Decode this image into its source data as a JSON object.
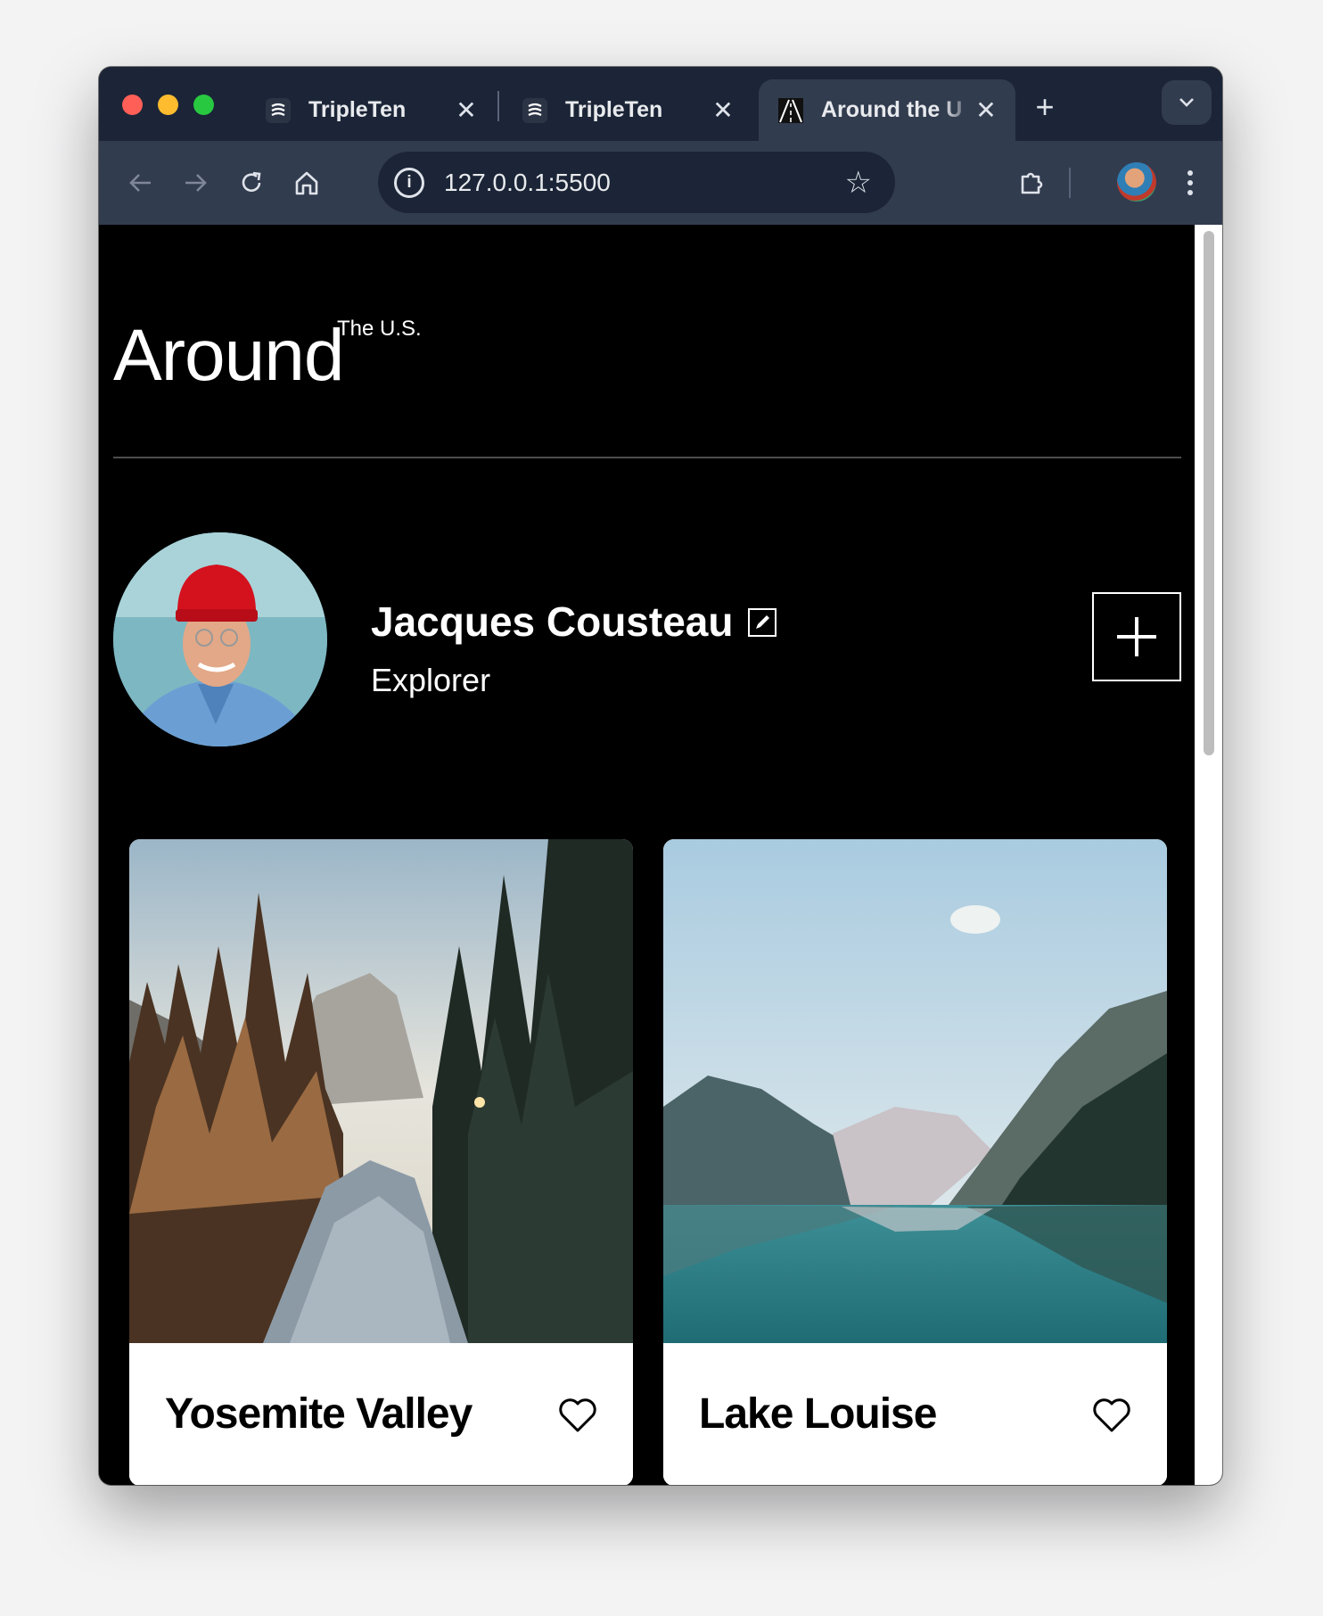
{
  "browser": {
    "tabs": [
      {
        "title": "TripleTen",
        "favicon": "tripleten-icon",
        "active": false
      },
      {
        "title": "TripleTen",
        "favicon": "tripleten-icon",
        "active": false
      },
      {
        "title": "Around the U",
        "favicon": "road-icon",
        "active": true
      }
    ],
    "close_glyph": "✕",
    "new_tab_glyph": "+",
    "url": "127.0.0.1:5500",
    "info_glyph": "i",
    "star_glyph": "☆"
  },
  "page": {
    "logo": {
      "main": "Around",
      "sup": "The U.S."
    },
    "profile": {
      "name": "Jacques Cousteau",
      "job": "Explorer"
    },
    "cards": [
      {
        "title": "Yosemite Valley",
        "image": "forest-river-photo"
      },
      {
        "title": "Lake Louise",
        "image": "mountain-lake-photo"
      }
    ]
  },
  "colors": {
    "page_background": "#000000",
    "tabstrip": "#1b2537",
    "toolbar": "#323c4f",
    "card_background": "#ffffff"
  }
}
